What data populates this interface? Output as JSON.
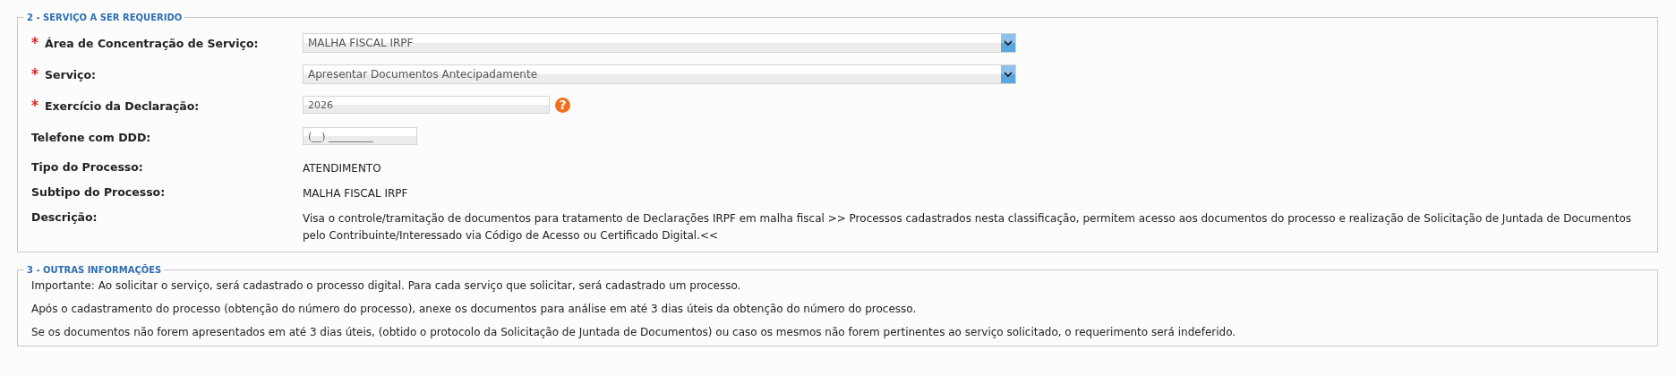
{
  "sections": [
    {
      "legend": "2 - SERVIÇO A SER REQUERIDO",
      "kind": "form",
      "rows": [
        {
          "label": "Área de Concentração de Serviço:",
          "required": true,
          "kind": "select",
          "value": "MALHA FISCAL IRPF"
        },
        {
          "label": "Serviço:",
          "required": true,
          "kind": "select",
          "value": "Apresentar Documentos Antecipadamente"
        },
        {
          "label": "Exercício da Declaração:",
          "required": true,
          "kind": "input",
          "value": "2026",
          "help": "?"
        },
        {
          "label": "Telefone com DDD:",
          "required": false,
          "kind": "phone",
          "value": "(__) _________"
        },
        {
          "label": "Tipo do Processo:",
          "required": false,
          "kind": "static",
          "value": "ATENDIMENTO"
        },
        {
          "label": "Subtipo do Processo:",
          "required": false,
          "kind": "static",
          "value": "MALHA FISCAL IRPF"
        },
        {
          "label": "Descrição:",
          "required": false,
          "kind": "static",
          "value": "Visa o controle/tramitação de documentos para tratamento de Declarações IRPF em malha fiscal >> Processos cadastrados nesta classificação, permitem acesso aos documentos do processo e realização de Solicitação de Juntada de Documentos pelo Contribuinte/Interessado via Código de Acesso ou Certificado Digital.<<"
        }
      ]
    },
    {
      "legend": "3 - OUTRAS INFORMAÇÕES",
      "kind": "notes",
      "paragraphs": [
        "Importante: Ao solicitar o serviço, será cadastrado o processo digital. Para cada serviço que solicitar, será cadastrado um processo.",
        "Após o cadastramento do processo (obtenção do número do processo), anexe os documentos para análise em até 3 dias úteis da obtenção do número do processo.",
        "Se os documentos não forem apresentados em até 3 dias úteis, (obtido o protocolo da Solicitação de Juntada de Documentos) ou caso os mesmos não forem pertinentes ao serviço solicitado, o requerimento será indeferido."
      ]
    }
  ]
}
